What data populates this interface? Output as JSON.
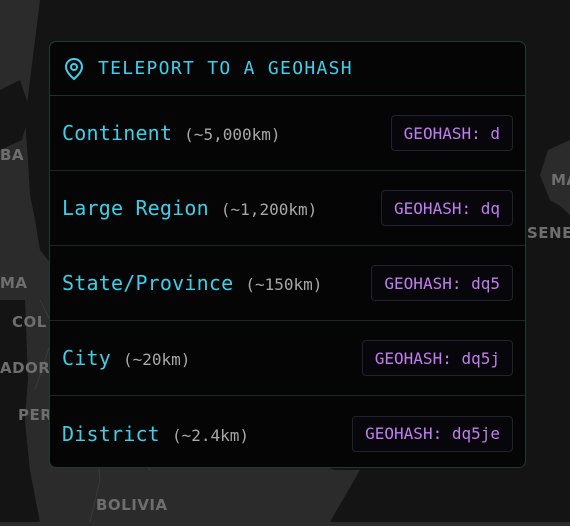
{
  "map": {
    "labels": [
      "BA",
      "MA",
      "COL",
      "ADOR",
      "PER",
      "BOLIVIA",
      "MA",
      "SENEG"
    ]
  },
  "panel": {
    "title": "TELEPORT TO A GEOHASH",
    "icon": "map-pin-icon",
    "rows": [
      {
        "name": "Continent",
        "size": "(~5,000km)",
        "button": "GEOHASH: d"
      },
      {
        "name": "Large Region",
        "size": "(~1,200km)",
        "button": "GEOHASH: dq"
      },
      {
        "name": "State/Province",
        "size": "(~150km)",
        "button": "GEOHASH: dq5"
      },
      {
        "name": "City",
        "size": "(~20km)",
        "button": "GEOHASH: dq5j"
      },
      {
        "name": "District",
        "size": "(~2.4km)",
        "button": "GEOHASH: dq5je"
      }
    ]
  },
  "colors": {
    "accent_cyan": "#3ccfe8",
    "accent_purple": "#c27df0",
    "panel_bg": "#050505",
    "map_land": "#2b2b2b",
    "map_water": "#141414"
  }
}
